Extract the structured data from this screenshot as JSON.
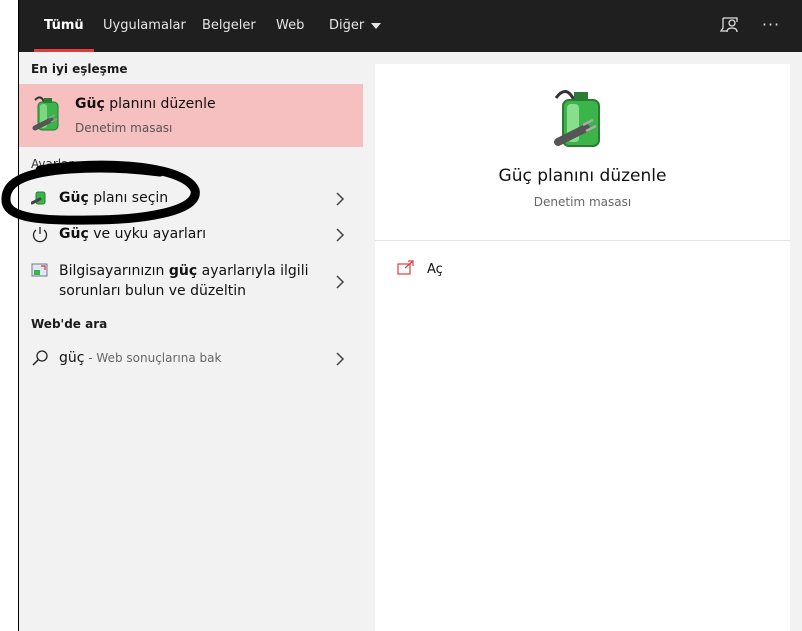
{
  "tabs": [
    "Tümü",
    "Uygulamalar",
    "Belgeler",
    "Web",
    "Diğer"
  ],
  "toolbar_icons": {
    "feedback": "feedback-icon",
    "more": "more-options-icon",
    "more_glyph": "···"
  },
  "left": {
    "best_match_heading": "En iyi eşleşme",
    "best_match": {
      "title_bold": "Güç",
      "title_rest": " planını düzenle",
      "subtitle": "Denetim masası",
      "icon": "power-options-icon"
    },
    "settings_heading": "Ayarlar",
    "settings": [
      {
        "bold": "Güç",
        "rest": " planı seçin",
        "icon": "power-plan-icon"
      },
      {
        "bold": "Güç",
        "rest": " ve uyku ayarları",
        "icon": "power-button-icon"
      },
      {
        "pre": "Bilgisayarınızın ",
        "bold": "güç",
        "rest": " ayarlarıyla ilgili",
        "line2": "sorunları bulun ve düzeltin",
        "icon": "troubleshoot-icon"
      }
    ],
    "web_heading": "Web'de ara",
    "web": {
      "query": "güç",
      "suffix": " - Web sonuçlarına bak",
      "icon": "search-icon"
    }
  },
  "preview": {
    "title": "Güç planını düzenle",
    "subtitle": "Denetim masası",
    "actions": [
      {
        "label": "Aç",
        "icon": "open-icon"
      }
    ]
  },
  "colors": {
    "accent": "#e33b3b",
    "highlight": "#f6bfc0",
    "topbar": "#1f1f1f",
    "pane": "#f2f2f2"
  }
}
